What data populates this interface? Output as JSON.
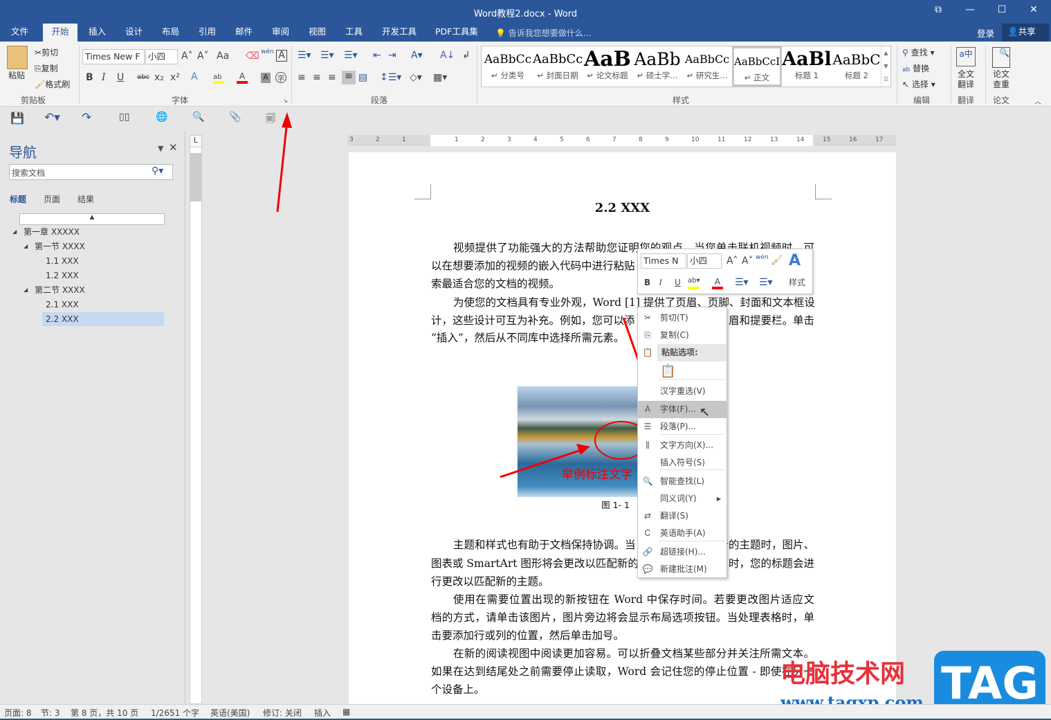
{
  "title": "Word教程2.docx - Word",
  "window_controls": [
    "⧉",
    "—",
    "☐",
    "✕"
  ],
  "tabs": [
    "文件",
    "开始",
    "插入",
    "设计",
    "布局",
    "引用",
    "邮件",
    "审阅",
    "视图",
    "工具",
    "开发工具",
    "PDF工具集"
  ],
  "active_tab": "开始",
  "tell_me": "告诉我您想要做什么...",
  "login": "登录",
  "share": "共享",
  "ribbon": {
    "clipboard": {
      "paste": "粘贴",
      "cut": "剪切",
      "copy": "复制",
      "format_painter": "格式刷",
      "label": "剪贴板"
    },
    "font": {
      "name": "Times New F",
      "size": "小四",
      "label": "字体",
      "bold": "B",
      "italic": "I",
      "underline": "U",
      "strike": "abc",
      "sub": "x₂",
      "sup": "x²",
      "grow": "A˄",
      "shrink": "A˅",
      "case": "Aa",
      "phonetic": "wén",
      "highlight_color": "#ffff00",
      "font_color": "#ff0000"
    },
    "paragraph": {
      "label": "段落"
    },
    "styles": {
      "label": "样式",
      "items": [
        {
          "preview": "AaBbCc",
          "name": "↵ 分类号"
        },
        {
          "preview": "AaBbCc",
          "name": "↵ 封面日期"
        },
        {
          "preview": "AaB",
          "name": "↵ 论文标题"
        },
        {
          "preview": "AaBb",
          "name": "↵ 硕士学..."
        },
        {
          "preview": "AaBbCc",
          "name": "↵ 研究生..."
        },
        {
          "preview": "AaBbCcI",
          "name": "↵ 正文"
        },
        {
          "preview": "AaBl",
          "name": "标题 1"
        },
        {
          "preview": "AaBbC",
          "name": "标题 2"
        }
      ],
      "selected": "↵ 正文"
    },
    "editing": {
      "find": "查找",
      "replace": "替换",
      "select": "选择",
      "label": "编辑"
    },
    "translate": {
      "button": "全文\n翻译",
      "label": "翻译"
    },
    "paper": {
      "button": "论文\n查重",
      "label": "论文"
    }
  },
  "nav": {
    "title": "导航",
    "search_placeholder": "搜索文档",
    "tabs": [
      "标题",
      "页面",
      "结果"
    ],
    "tree": [
      {
        "label": "第一章 XXXXX",
        "level": 0,
        "expanded": true
      },
      {
        "label": "第一节 XXXX",
        "level": 1,
        "expanded": true
      },
      {
        "label": "1.1 XXX",
        "level": 2
      },
      {
        "label": "1.2 XXX",
        "level": 2
      },
      {
        "label": "第二节 XXXX",
        "level": 1,
        "expanded": true
      },
      {
        "label": "2.1 XXX",
        "level": 2
      },
      {
        "label": "2.2 XXX",
        "level": 2,
        "selected": true
      }
    ]
  },
  "ruler_numbers": [
    "3",
    "2",
    "1",
    "1",
    "2",
    "3",
    "4",
    "5",
    "6",
    "7",
    "8",
    "9",
    "10",
    "11",
    "12",
    "13",
    "14",
    "15",
    "16",
    "17"
  ],
  "doc": {
    "heading": "2.2 XXX",
    "lines": [
      {
        "text": "视频提供了功能强大的方法帮助您证明您的观点。当您单击联机视频时，可",
        "indent": true,
        "full": true
      },
      {
        "text": "以在想要添加的视频的嵌入代码中进行粘贴"
      },
      {
        "text": "索最适合您的文档的视频。"
      },
      {
        "text": "为使您的文档具有专业外观，Word [1] 提供了页眉、页脚、封面和文本框设",
        "indent": true,
        "full": true
      },
      {
        "text": "计，这些设计可互为补充。例如，您可以添",
        "right": "眉和提要栏。单击"
      },
      {
        "text": "“插入”，然后从不同库中选择所需元素。"
      },
      {
        "text": "主题和样式也有助于文档保持协调。当",
        "right": "新的主题时，图片、",
        "indent": true
      },
      {
        "text": "图表或 SmartArt 图形将会更改以匹配新的",
        "right": "时，您的标题会进"
      },
      {
        "text": "行更改以匹配新的主题。"
      },
      {
        "text": "使用在需要位置出现的新按钮在 Word 中保存时间。若要更改图片适应文",
        "indent": true,
        "full": true
      },
      {
        "text": "档的方式，请单击该图片，图片旁边将会显示布局选项按钮。当处理表格时，单",
        "full": true
      },
      {
        "text": "击要添加行或列的位置，然后单击加号。"
      },
      {
        "text": "在新的阅读视图中阅读更加容易。可以折叠文档某些部分并关注所需文本。",
        "indent": true,
        "full": true
      },
      {
        "text": "如果在达到结尾处之前需要停止读取，Word 会记住您的停止位置 - 即使在另一",
        "full": true
      },
      {
        "text": "个设备上。"
      }
    ],
    "image_annotation": "举例标注文字",
    "caption": "图 1- 1"
  },
  "mini_toolbar": {
    "font": "Times N",
    "size": "小四",
    "styles": "样式"
  },
  "context_menu": [
    {
      "icon": "scissors-icon",
      "glyph": "✂",
      "label": "剪切(T)"
    },
    {
      "icon": "copy-icon",
      "glyph": "⎘",
      "label": "复制(C)"
    },
    {
      "icon": "paste-icon",
      "glyph": "📋",
      "label": "粘贴选项:",
      "header": true
    },
    {
      "icon": "paste-keep-icon",
      "glyph": "📋",
      "label": "",
      "paste_opt": true
    },
    {
      "icon": "",
      "glyph": "",
      "label": "汉字重选(V)"
    },
    {
      "icon": "font-icon",
      "glyph": "A",
      "label": "字体(F)...",
      "hover": true
    },
    {
      "icon": "paragraph-icon",
      "glyph": "☰",
      "label": "段落(P)..."
    },
    {
      "icon": "text-direction-icon",
      "glyph": "⫼",
      "label": "文字方向(X)..."
    },
    {
      "icon": "",
      "glyph": "",
      "label": "插入符号(S)"
    },
    {
      "icon": "smart-lookup-icon",
      "glyph": "🔍",
      "label": "智能查找(L)"
    },
    {
      "icon": "",
      "glyph": "",
      "label": "同义词(Y)",
      "submenu": true
    },
    {
      "icon": "translate-icon",
      "glyph": "⇄",
      "label": "翻译(S)"
    },
    {
      "icon": "english-assistant-icon",
      "glyph": "Ꮯ",
      "label": "英语助手(A)"
    },
    {
      "icon": "hyperlink-icon",
      "glyph": "🔗",
      "label": "超链接(H)..."
    },
    {
      "icon": "new-comment-icon",
      "glyph": "💬",
      "label": "新建批注(M)"
    }
  ],
  "status": [
    "页面: 8",
    "节: 3",
    "第 8 页，共 10 页",
    "1/2651 个字",
    "英语(美国)",
    "修订: 关闭",
    "插入"
  ],
  "watermark": {
    "cn": "电脑技术网",
    "url": "www.tagxp.com",
    "tag": "TAG"
  },
  "colors": {
    "brand": "#2b579a",
    "annotation": "#e00000"
  }
}
